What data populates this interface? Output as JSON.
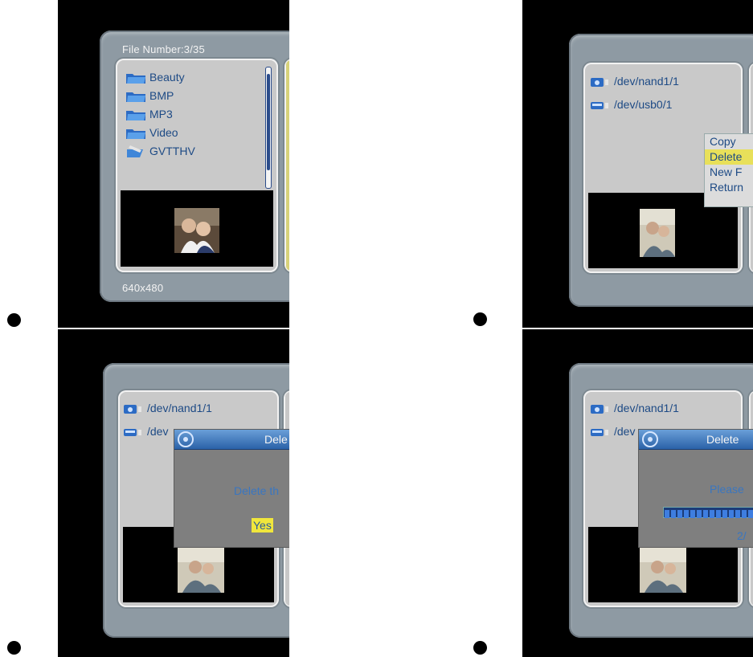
{
  "screens": {
    "file_list": {
      "header": "File Number:3/35",
      "items": [
        {
          "label": "Beauty",
          "icon": "folder-icon"
        },
        {
          "label": "BMP",
          "icon": "folder-icon"
        },
        {
          "label": "MP3",
          "icon": "folder-icon"
        },
        {
          "label": "Video",
          "icon": "folder-icon"
        },
        {
          "label": "GVTTHV",
          "icon": "folder-open-icon"
        }
      ],
      "footer": "640x480"
    },
    "context_menu": {
      "devices": [
        {
          "label": "/dev/nand1/1",
          "icon": "camera-device-icon"
        },
        {
          "label": "/dev/usb0/1",
          "icon": "usb-device-icon"
        }
      ],
      "menu_items": [
        "Copy",
        "Delete",
        "New F",
        "Return"
      ],
      "selected": "Delete"
    },
    "delete_confirm": {
      "devices": [
        {
          "label": "/dev/nand1/1"
        },
        {
          "label": "/dev"
        }
      ],
      "dialog_title": "Dele",
      "message": "Delete th",
      "yes_label": "Yes"
    },
    "delete_progress": {
      "devices": [
        {
          "label": "/dev/nand1/1"
        },
        {
          "label": "/dev"
        }
      ],
      "dialog_title": "Delete",
      "message": "Please",
      "count_text": "2/",
      "progress_fraction": 0.85
    }
  },
  "colors": {
    "accent_text": "#1d4a85",
    "highlight": "#e8e05a",
    "dialog_title": "#2b62a8"
  }
}
